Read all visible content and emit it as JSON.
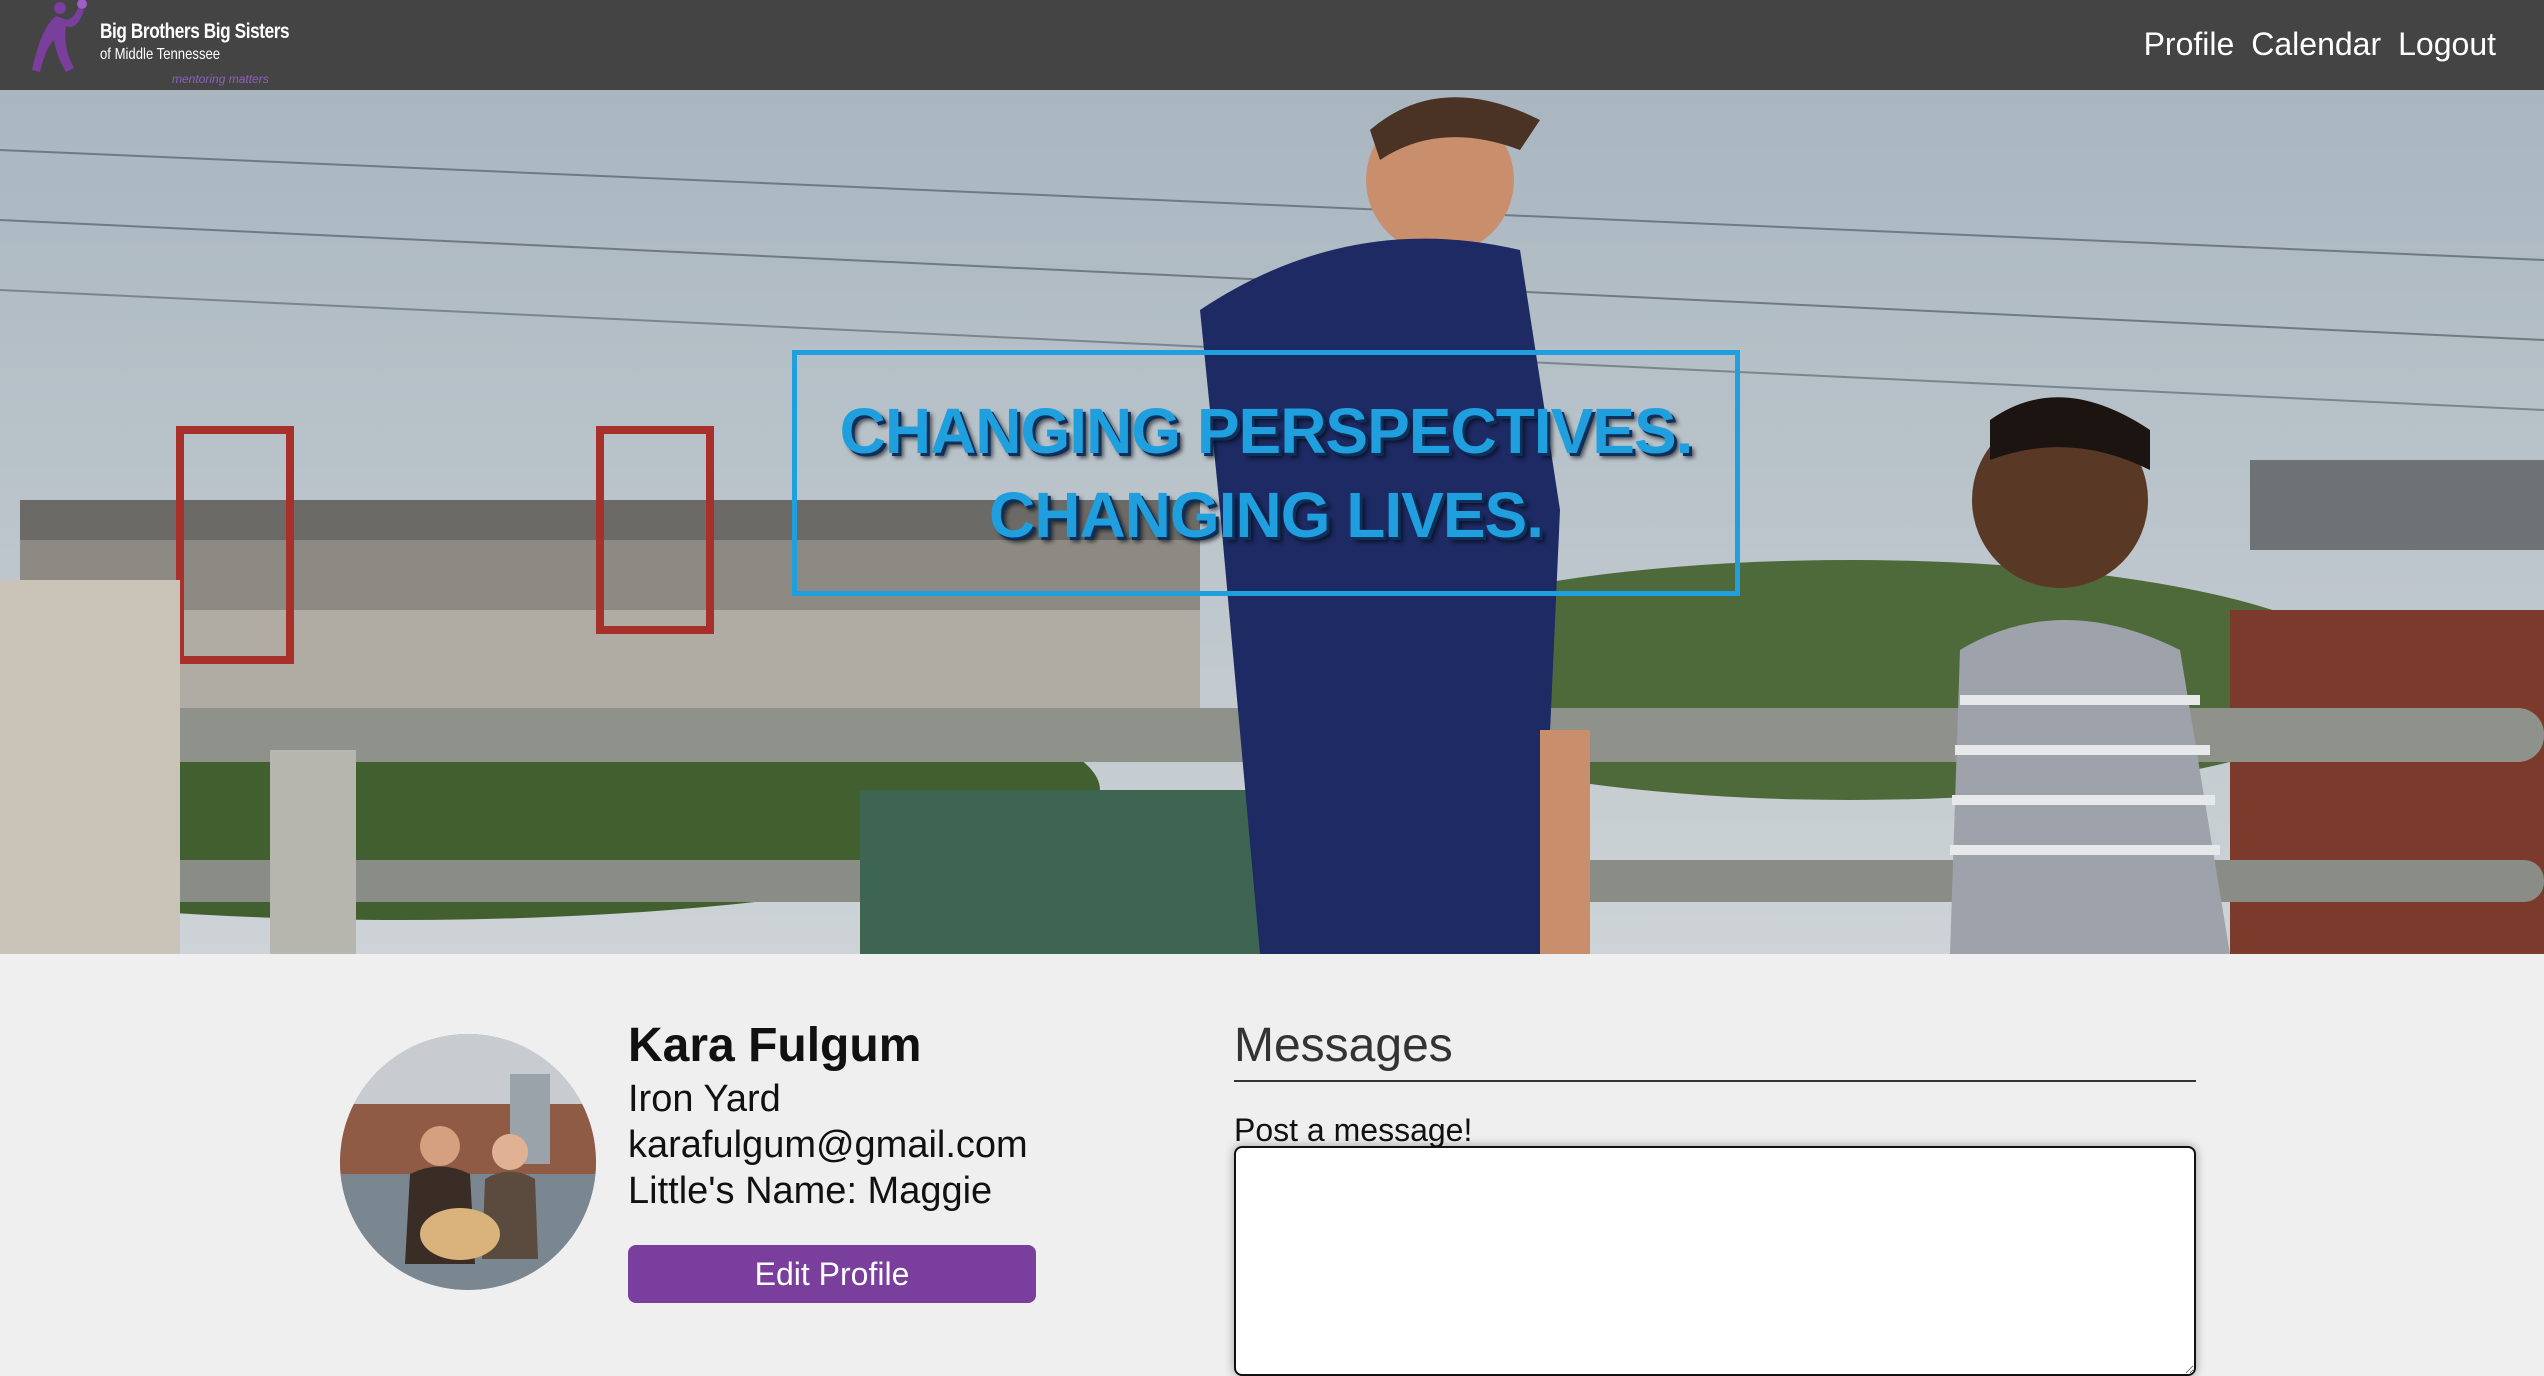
{
  "brand": {
    "line1": "Big Brothers Big Sisters",
    "line2": "of Middle Tennessee",
    "tagline": "mentoring matters",
    "accent_color": "#7a3e9d"
  },
  "nav": {
    "links": [
      {
        "label": "Profile"
      },
      {
        "label": "Calendar"
      },
      {
        "label": "Logout"
      }
    ]
  },
  "hero": {
    "line1": "CHANGING PERSPECTIVES.",
    "line2": "CHANGING LIVES.",
    "text_color": "#1f9fde"
  },
  "profile": {
    "name": "Kara Fulgum",
    "organization": "Iron Yard",
    "email": "karafulgum@gmail.com",
    "little": "Little's Name: Maggie",
    "edit_button": "Edit Profile"
  },
  "messages": {
    "title": "Messages",
    "prompt": "Post a message!",
    "input_value": ""
  }
}
